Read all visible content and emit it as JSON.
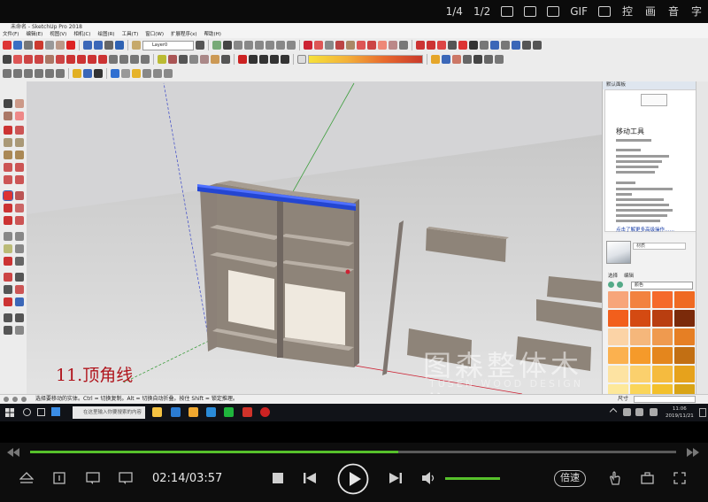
{
  "player_top": {
    "items": [
      "1/4",
      "1/2",
      "",
      "",
      "",
      "GIF",
      "",
      "控",
      "画",
      "音",
      "字"
    ]
  },
  "sketchup": {
    "title": "未命名 - SketchUp Pro 2018",
    "menu": [
      "文件(F)",
      "编辑(E)",
      "视图(V)",
      "相机(C)",
      "绘图(R)",
      "工具(T)",
      "窗口(W)",
      "扩展程序(x)",
      "帮助(H)"
    ],
    "layer": "Layer0",
    "tray_title": "默认面板",
    "instructor": {
      "heading": "移动工具",
      "more_link": "点击了解更多高级操作……"
    },
    "materials": {
      "name": "材质",
      "tab_select": "选择",
      "tab_edit": "编辑",
      "category": "颜色",
      "swatch_colors": [
        "#f7a57a",
        "#f2823f",
        "#f56a2b",
        "#ef6a22",
        "#f25f1c",
        "#d44a12",
        "#b93e10",
        "#7b2a0a",
        "#fbd3a6",
        "#f5b77b",
        "#ef9a4f",
        "#e67f24",
        "#fbb14f",
        "#f59a2a",
        "#e4861d",
        "#c26f13",
        "#fde3a2",
        "#fbd06d",
        "#f5bb3f",
        "#e6a21c",
        "#fde89a",
        "#fad55a",
        "#f3c02c",
        "#d9a416"
      ]
    },
    "status": "选择要移动的实体。Ctrl = 切换复制。Alt = 切换自动折叠。按住 Shift = 锁定推理。",
    "status_right": "尺寸",
    "caption": "11.顶角线",
    "watermark": "图森整体木作",
    "watermark_sub": "TUSEN WOOD DESIGN"
  },
  "taskbar": {
    "search_placeholder": "在这里输入你要搜索的内容",
    "time": "11:06",
    "date": "2019/11/21"
  },
  "player": {
    "current_time": "02:14",
    "total_time": "03:57",
    "time_display": "02:14/03:57",
    "progress": 0.57,
    "volume": 1.0,
    "speed_label": "倍速"
  }
}
